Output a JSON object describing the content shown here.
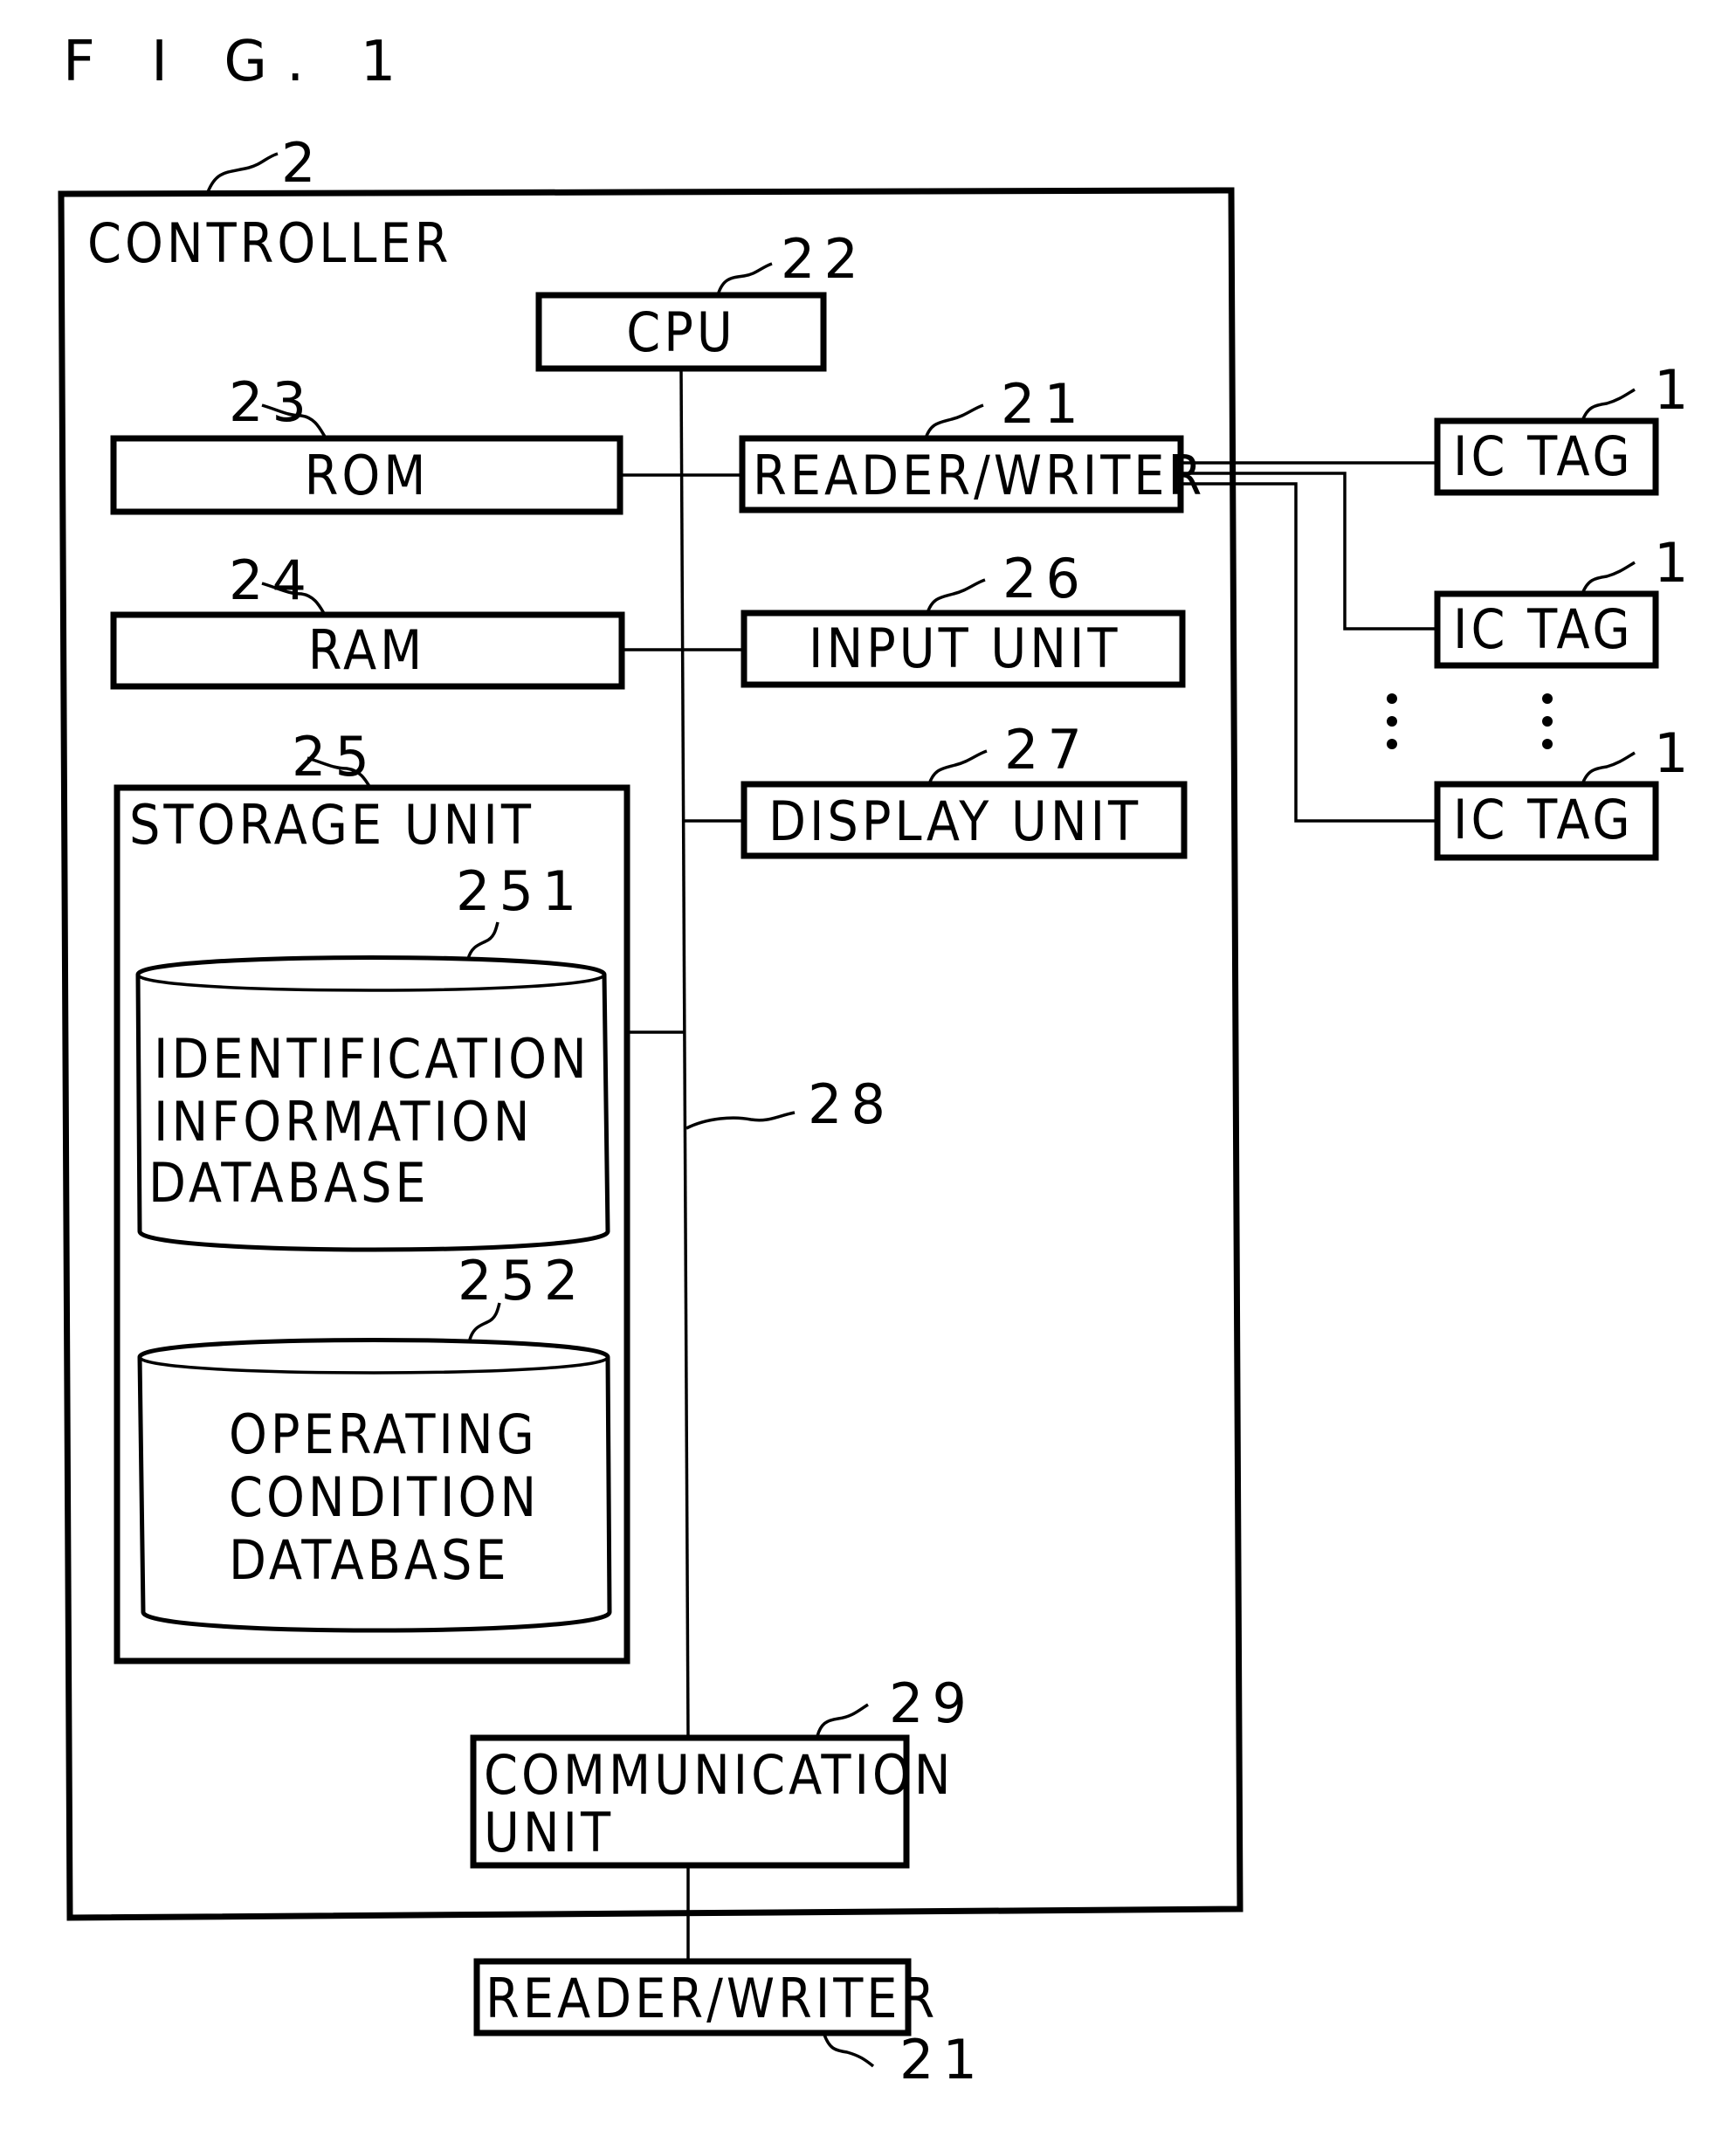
{
  "figure": {
    "title": "F I G. 1"
  },
  "controller": {
    "label": "CONTROLLER",
    "ref": "2"
  },
  "cpu": {
    "label": "CPU",
    "ref": "22"
  },
  "rom": {
    "label": "ROM",
    "ref": "23"
  },
  "ram": {
    "label": "RAM",
    "ref": "24"
  },
  "storage": {
    "label": "STORAGE UNIT",
    "ref": "25"
  },
  "db1": {
    "lines": [
      "IDENTIFICATION",
      "INFORMATION",
      "DATABASE"
    ],
    "ref": "251"
  },
  "db2": {
    "lines": [
      "OPERATING",
      "CONDITION",
      "DATABASE"
    ],
    "ref": "252"
  },
  "reader_writer_top": {
    "label": "READER/WRITER",
    "ref": "21"
  },
  "input_unit": {
    "label": "INPUT UNIT",
    "ref": "26"
  },
  "display_unit": {
    "label": "DISPLAY UNIT",
    "ref": "27"
  },
  "bus": {
    "ref": "28"
  },
  "communication_unit": {
    "lines": [
      "COMMUNICATION",
      "UNIT"
    ],
    "ref": "29"
  },
  "reader_writer_bottom": {
    "label": "READER/WRITER",
    "ref": "21"
  },
  "ic_tags": [
    {
      "label": "IC TAG",
      "ref": "1"
    },
    {
      "label": "IC TAG",
      "ref": "1"
    },
    {
      "label": "IC TAG",
      "ref": "1"
    }
  ],
  "ellipsis": "⋮"
}
